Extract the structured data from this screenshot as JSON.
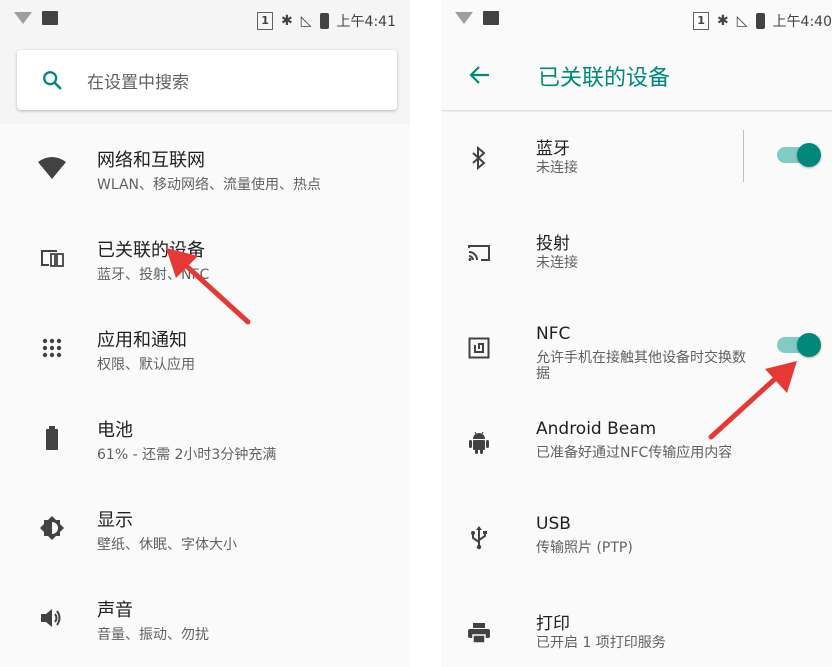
{
  "colors": {
    "accent": "#00897b",
    "arrow": "#e53935"
  },
  "left_screen": {
    "status": {
      "sim": "1",
      "time": "上午4:41"
    },
    "search": {
      "placeholder": "在设置中搜索"
    },
    "items": [
      {
        "title": "网络和互联网",
        "subtitle": "WLAN、移动网络、流量使用、热点",
        "icon": "wifi-icon"
      },
      {
        "title": "已关联的设备",
        "subtitle": "蓝牙、投射、NFC",
        "icon": "devices-icon"
      },
      {
        "title": "应用和通知",
        "subtitle": "权限、默认应用",
        "icon": "apps-icon"
      },
      {
        "title": "电池",
        "subtitle": "61% - 还需 2小时3分钟充满",
        "icon": "battery-icon"
      },
      {
        "title": "显示",
        "subtitle": "壁纸、休眠、字体大小",
        "icon": "brightness-icon"
      },
      {
        "title": "声音",
        "subtitle": "音量、振动、勿扰",
        "icon": "volume-icon"
      }
    ]
  },
  "right_screen": {
    "status": {
      "sim": "1",
      "time": "上午4:40"
    },
    "appbar": {
      "title": "已关联的设备"
    },
    "items": [
      {
        "title": "蓝牙",
        "subtitle": "未连接",
        "icon": "bluetooth-icon",
        "toggle": true
      },
      {
        "title": "投射",
        "subtitle": "未连接",
        "icon": "cast-icon"
      },
      {
        "title": "NFC",
        "subtitle": "允许手机在接触其他设备时交换数据",
        "icon": "nfc-icon",
        "toggle": true
      },
      {
        "title": "Android Beam",
        "subtitle": "已准备好通过NFC传输应用内容",
        "icon": "android-icon"
      },
      {
        "title": "USB",
        "subtitle": "传输照片 (PTP)",
        "icon": "usb-icon"
      },
      {
        "title": "打印",
        "subtitle": "已开启 1 项打印服务",
        "icon": "print-icon"
      }
    ]
  }
}
